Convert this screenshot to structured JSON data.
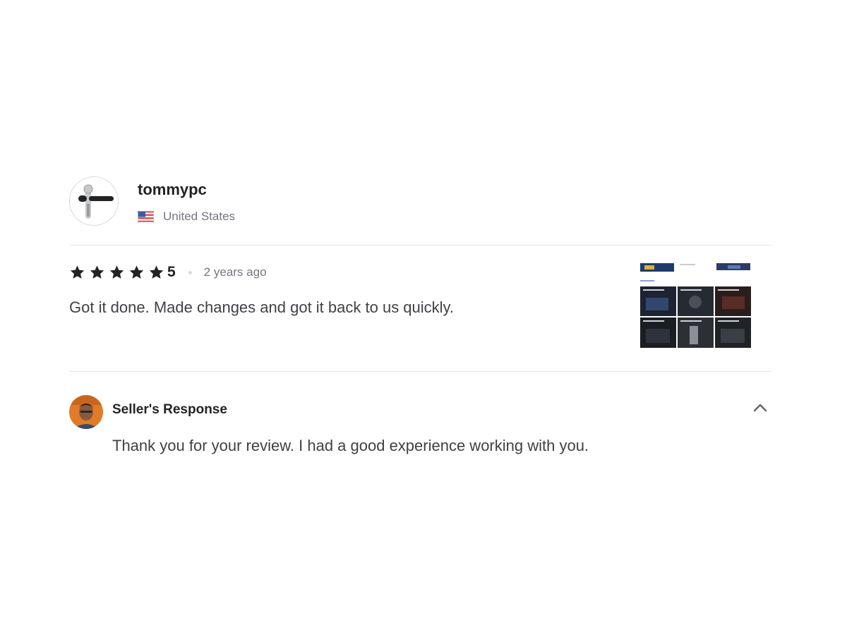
{
  "reviewer": {
    "username": "tommypc",
    "country": "United States",
    "avatar_icon": "key-icon",
    "flag_icon": "us-flag-icon"
  },
  "review": {
    "stars": 5,
    "rating_label": "5",
    "time_ago": "2 years ago",
    "text": "Got it done. Made changes and got it back to us quickly.",
    "attachment_icon": "portfolio-thumbnail"
  },
  "response": {
    "title": "Seller's Response",
    "text": "Thank you for your review. I had a good experience working with you.",
    "collapse_icon": "chevron-up-icon"
  },
  "colors": {
    "text_dark": "#222325",
    "text_body": "#404145",
    "text_muted": "#74767e",
    "divider": "#e4e5e7",
    "star": "#222325"
  }
}
